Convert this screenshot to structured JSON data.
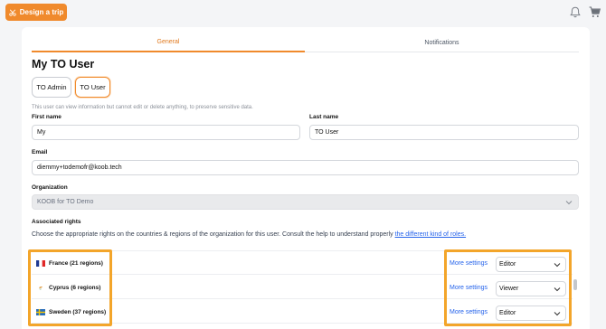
{
  "header": {
    "design_button_label": "Design a trip"
  },
  "tabs": [
    {
      "label": "General",
      "active": true
    },
    {
      "label": "Notifications",
      "active": false
    }
  ],
  "page_title": "My TO User",
  "roles": [
    {
      "label": "TO Admin",
      "selected": false
    },
    {
      "label": "TO User",
      "selected": true
    }
  ],
  "hint": "This user can view information but cannot edit or delete anything, to preserve sensitive data.",
  "form": {
    "first_name_label": "First name",
    "first_name_value": "My",
    "last_name_label": "Last name",
    "last_name_value": "TO User",
    "email_label": "Email",
    "email_value": "diemmy+todemofr@koob.tech",
    "organization_label": "Organization",
    "organization_value": "KOOB for TO Demo"
  },
  "rights": {
    "title": "Associated rights",
    "description": "Choose the appropriate rights on the countries & regions of the organization for this user. Consult the help to understand properly",
    "link": "the different kind of roles.",
    "more_settings_label": "More settings",
    "rows": [
      {
        "country": "France (21 regions)",
        "flag": "france-flag-icon",
        "role": "Editor"
      },
      {
        "country": "Cyprus (6 regions)",
        "flag": "cyprus-flag-icon",
        "role": "Viewer"
      },
      {
        "country": "Sweden (37 regions)",
        "flag": "sweden-flag-icon",
        "role": "Editor"
      }
    ]
  },
  "colors": {
    "accent": "#f08a2c",
    "link": "#2563eb",
    "highlight": "#f3a52a"
  }
}
